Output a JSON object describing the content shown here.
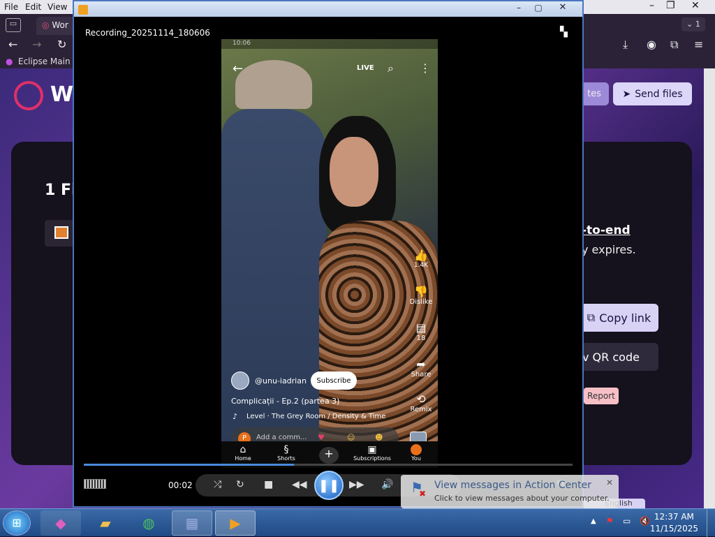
{
  "browser": {
    "menu": [
      "File",
      "Edit",
      "View"
    ],
    "tab_label": "Wor",
    "bookmark": "Eclipse Main S",
    "tab_count": "1",
    "page": {
      "logo_text": "W",
      "notes_label": "tes",
      "send_files_label": "Send files",
      "files_heading": "1 Fi",
      "e2e_text": "-to-end",
      "expires_text": "y expires.",
      "copy_link_label": "Copy link",
      "qr_label": "v QR code",
      "report_label": "Report",
      "english_label": "English"
    }
  },
  "player": {
    "window_title": "",
    "recording_name": "Recording_20251114_180606",
    "time": "00:02",
    "progress": 0.43,
    "phone": {
      "status": "10:06",
      "live_label": "LIVE",
      "likes": "1.4K",
      "dislike_label": "Dislike",
      "comments": "18",
      "share_label": "Share",
      "remix_label": "Remix",
      "channel": "@unu-iadrian",
      "subscribe_label": "Subscribe",
      "video_title": "Complicații - Ep.2 (partea 3)",
      "music": "Level · The Grey Room / Density & Time",
      "comment_placeholder": "Add a comm...",
      "avatar_letter": "P",
      "nav": [
        "Home",
        "Shorts",
        "",
        "Subscriptions",
        "You"
      ]
    }
  },
  "notification": {
    "title": "View messages in Action Center",
    "body": "Click to view messages about your computer."
  },
  "taskbar": {
    "time": "12:37 AM",
    "date": "11/15/2025"
  },
  "colors": {
    "accent": "#4a8adc",
    "taskbar": "#1f4a84"
  }
}
